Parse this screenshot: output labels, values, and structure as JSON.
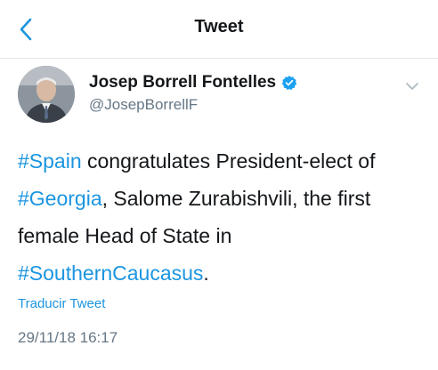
{
  "nav": {
    "title": "Tweet",
    "back_icon": "chevron-left-icon"
  },
  "author": {
    "display_name": "Josep Borrell Fontelles",
    "handle": "@JosepBorrellF",
    "verified_icon": "verified-badge-icon",
    "menu_icon": "chevron-down-icon"
  },
  "tweet": {
    "line1": {
      "hashtag": "#Spain",
      "text": " congratulates President-elect of"
    },
    "line2": {
      "hashtag": "#Georgia",
      "text": ", Salome Zurabishvili, the first"
    },
    "line3": {
      "text": "female Head of State in"
    },
    "line4": {
      "hashtag": "#SouthernCaucasus",
      "text": "."
    }
  },
  "translate_label": "Traducir Tweet",
  "timestamp": "29/11/18 16:17",
  "colors": {
    "accent": "#1b95e0",
    "text": "#14171a",
    "secondary": "#657786",
    "divider": "#e1e8ed"
  }
}
